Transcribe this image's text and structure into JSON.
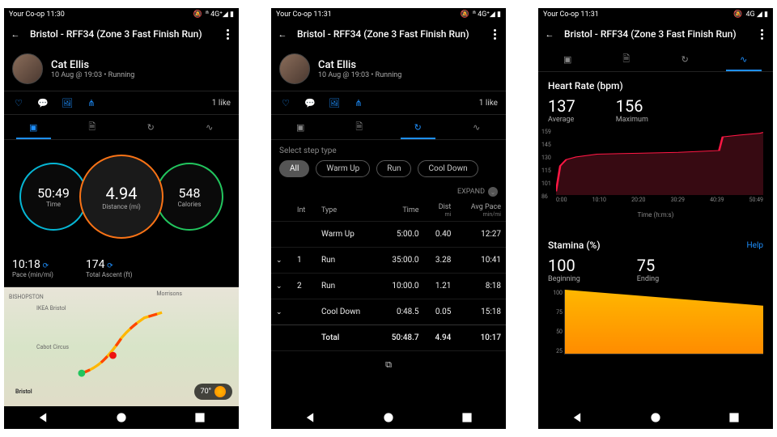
{
  "status": {
    "carrier": "Your Co-op",
    "time1": "11:30",
    "time2": "11:31",
    "time3": "11:31",
    "signal1": "ⁿ 4G⁺◢ ▮",
    "signal2": "ⁿ 4G⁺◢ ▮",
    "signal3": "4G ◢ ▮"
  },
  "header": {
    "title": "Bristol - RFF34 (Zone 3 Fast Finish Run)"
  },
  "user": {
    "name": "Cat Ellis",
    "subtitle": "10 Aug @ 19:03 • Running"
  },
  "social": {
    "likes": "1 like"
  },
  "colors": {
    "accent": "#1e90ff",
    "time_ring": "#06b6d4",
    "dist_ring": "#f97316",
    "cal_ring": "#22c55e"
  },
  "summary": {
    "time": {
      "value": "50:49",
      "label": "Time"
    },
    "distance": {
      "value": "4.94",
      "label": "Distance (mi)"
    },
    "calories": {
      "value": "548",
      "label": "Calories"
    },
    "pace": {
      "value": "10:18",
      "label": "Pace (min/mi)"
    },
    "ascent": {
      "value": "174",
      "label": "Total Ascent (ft)"
    }
  },
  "map": {
    "weather_temp": "70°",
    "locations": [
      "BISHOPSTON",
      "IKEA Bristol",
      "Morrisons",
      "Cabot Circus",
      "Bristol"
    ]
  },
  "intervals": {
    "select_label": "Select step type",
    "chips": {
      "all": "All",
      "warmup": "Warm Up",
      "run": "Run",
      "cooldown": "Cool Down"
    },
    "expand": "EXPAND",
    "headers": {
      "int": "Int",
      "type": "Type",
      "time": "Time",
      "dist": "Dist",
      "dist_unit": "mi",
      "pace": "Avg Pace",
      "pace_unit": "min/mi"
    },
    "rows": [
      {
        "chevron": "",
        "int": "",
        "type": "Warm Up",
        "time": "5:00.0",
        "dist": "0.40",
        "pace": "12:27"
      },
      {
        "chevron": "⌄",
        "int": "1",
        "type": "Run",
        "time": "35:00.0",
        "dist": "3.28",
        "pace": "10:41"
      },
      {
        "chevron": "⌄",
        "int": "2",
        "type": "Run",
        "time": "10:00.0",
        "dist": "1.21",
        "pace": "8:18"
      },
      {
        "chevron": "⌄",
        "int": "",
        "type": "Cool Down",
        "time": "0:48.5",
        "dist": "0.05",
        "pace": "15:18"
      }
    ],
    "total": {
      "label": "Total",
      "time": "50:48.7",
      "dist": "4.94",
      "pace": "10:17"
    }
  },
  "hr": {
    "title": "Heart Rate (bpm)",
    "avg": {
      "value": "137",
      "label": "Average"
    },
    "max": {
      "value": "156",
      "label": "Maximum"
    },
    "xlabel": "Time (h:m:s)"
  },
  "stamina": {
    "title": "Stamina (%)",
    "help": "Help",
    "begin": {
      "value": "100",
      "label": "Beginning"
    },
    "end": {
      "value": "75",
      "label": "Ending"
    }
  },
  "chart_data": [
    {
      "type": "line",
      "title": "Heart Rate (bpm)",
      "xlabel": "Time (h:m:s)",
      "ylabel": "bpm",
      "ylim": [
        86,
        159
      ],
      "y_ticks": [
        86,
        101,
        115,
        130,
        145,
        159
      ],
      "x_ticks": [
        "0:00",
        "10:10",
        "20:20",
        "30:29",
        "40:39",
        "50:49"
      ],
      "x_seconds": [
        0,
        610,
        1220,
        1829,
        2439,
        3049
      ],
      "series": [
        {
          "name": "Heart Rate",
          "x_seconds": [
            0,
            60,
            150,
            300,
            600,
            1200,
            1800,
            2100,
            2400,
            2450,
            2700,
            3000,
            3049
          ],
          "values": [
            90,
            118,
            125,
            128,
            131,
            132,
            133,
            134,
            135,
            150,
            152,
            154,
            155
          ]
        }
      ],
      "summary": {
        "average": 137,
        "maximum": 156
      }
    },
    {
      "type": "area",
      "title": "Stamina (%)",
      "ylabel": "%",
      "ylim": [
        25,
        100
      ],
      "y_ticks": [
        25,
        50,
        75,
        100
      ],
      "x_seconds": [
        0,
        3049
      ],
      "series": [
        {
          "name": "Stamina",
          "x_seconds": [
            0,
            3049
          ],
          "values": [
            100,
            75
          ]
        }
      ]
    }
  ]
}
